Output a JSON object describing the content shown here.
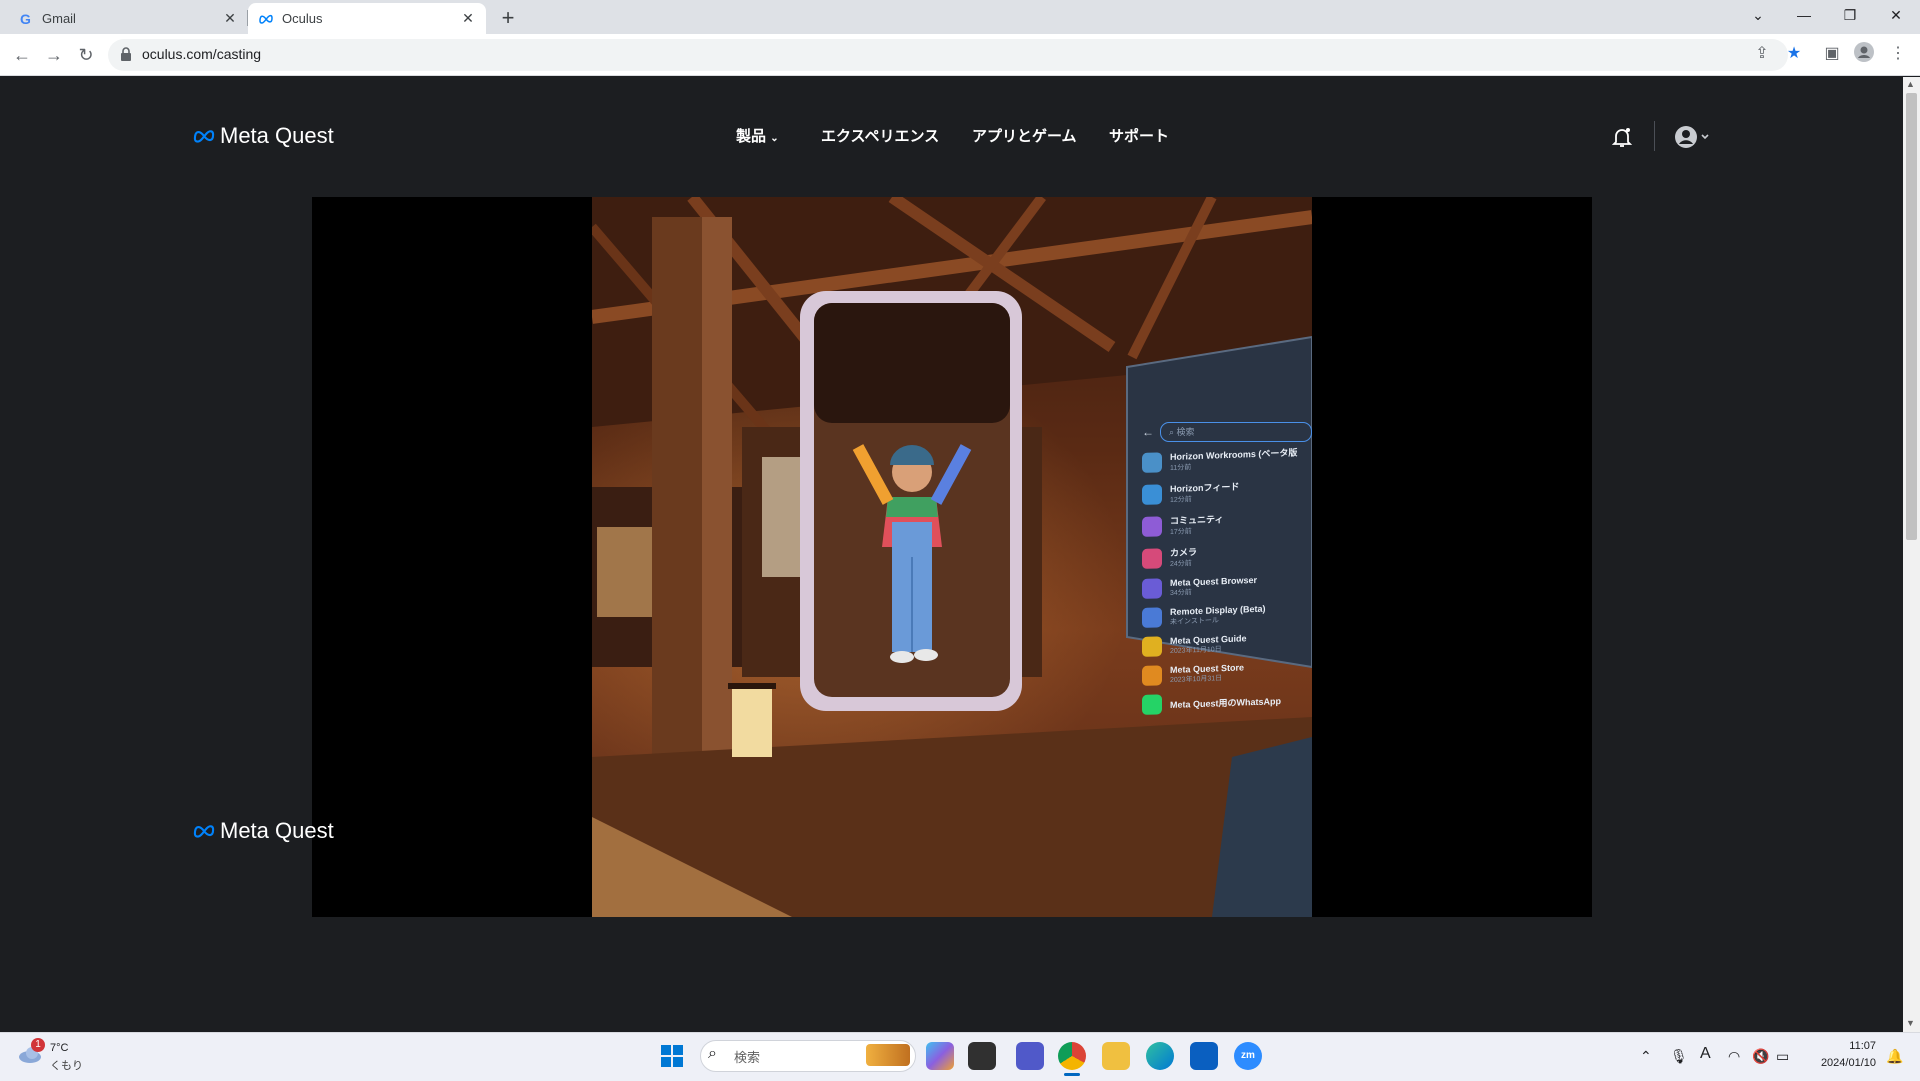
{
  "browser": {
    "tabs": [
      {
        "title": "Gmail",
        "favicon": "google-icon"
      },
      {
        "title": "Oculus",
        "favicon": "meta-icon",
        "active": true
      }
    ],
    "url": "oculus.com/casting"
  },
  "header": {
    "logo": "Meta Quest",
    "nav": [
      "製品",
      "エクスペリエンス",
      "アプリとゲーム",
      "サポート"
    ]
  },
  "vr_panel": {
    "search_placeholder": "検索",
    "apps": [
      {
        "name": "Horizon Workrooms (ベータ版",
        "sub": "11分前",
        "color": "#4a90c8"
      },
      {
        "name": "Horizonフィード",
        "sub": "12分前",
        "color": "#3a8fd6"
      },
      {
        "name": "コミュニティ",
        "sub": "17分前",
        "color": "#8e5cd6"
      },
      {
        "name": "カメラ",
        "sub": "24分前",
        "color": "#d64a7a"
      },
      {
        "name": "Meta Quest Browser",
        "sub": "34分前",
        "color": "#6a5cd6"
      },
      {
        "name": "Remote Display (Beta)",
        "sub": "未インストール",
        "color": "#4a7ad6"
      },
      {
        "name": "Meta Quest Guide",
        "sub": "2023年11月10日",
        "color": "#e0b020"
      },
      {
        "name": "Meta Quest Store",
        "sub": "2023年10月31日",
        "color": "#e08a20"
      },
      {
        "name": "Meta Quest用のWhatsApp",
        "sub": "",
        "color": "#25d366"
      }
    ]
  },
  "footer": {
    "logo": "Meta Quest"
  },
  "taskbar": {
    "weather_temp": "7°C",
    "weather_desc": "くもり",
    "weather_badge": "1",
    "search_placeholder": "検索",
    "time": "11:07",
    "date": "2024/01/10",
    "ime": "A"
  },
  "colors": {
    "page_bg": "#1c1e21",
    "meta_blue": "#0082fb"
  }
}
